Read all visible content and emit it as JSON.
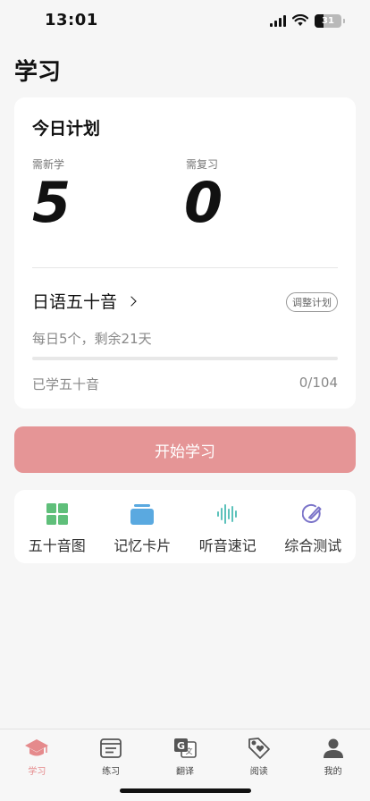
{
  "status_bar": {
    "time": "13:01",
    "battery": "31"
  },
  "page": {
    "title": "学习"
  },
  "plan": {
    "title": "今日计划",
    "new_label": "需新学",
    "new_value": "5",
    "review_label": "需复习",
    "review_value": "0",
    "course_name": "日语五十音",
    "adjust_label": "调整计划",
    "daily_info": "每日5个，剩余21天",
    "learned_label": "已学五十音",
    "learned_count": "0/104",
    "progress": 0
  },
  "start_button": {
    "label": "开始学习"
  },
  "tools": [
    {
      "label": "五十音图",
      "icon": "grid-icon"
    },
    {
      "label": "记忆卡片",
      "icon": "cards-icon"
    },
    {
      "label": "听音速记",
      "icon": "waveform-icon"
    },
    {
      "label": "综合测试",
      "icon": "test-pen-icon"
    }
  ],
  "tabs": [
    {
      "label": "学习",
      "icon": "graduation-cap-icon",
      "active": true
    },
    {
      "label": "练习",
      "icon": "practice-doc-icon",
      "active": false
    },
    {
      "label": "翻译",
      "icon": "translate-icon",
      "active": false
    },
    {
      "label": "阅读",
      "icon": "tag-heart-icon",
      "active": false
    },
    {
      "label": "我的",
      "icon": "person-icon",
      "active": false
    }
  ],
  "colors": {
    "accent": "#e59596",
    "green": "#5fbf7a",
    "blue": "#5aa9e0",
    "teal": "#5cc2bb",
    "purple": "#7b74c9"
  }
}
